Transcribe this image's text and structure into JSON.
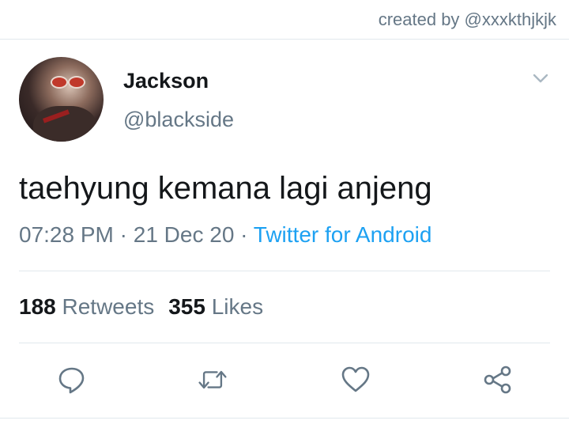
{
  "credit": "created by @xxxkthjkjk",
  "tweet": {
    "author_name": "Jackson",
    "author_handle": "@blackside",
    "text": "taehyung kemana lagi anjeng",
    "time": "07:28 PM",
    "date": "21 Dec 20",
    "separator": "·",
    "source": "Twitter for Android",
    "retweets_count": "188",
    "retweets_label": "Retweets",
    "likes_count": "355",
    "likes_label": "Likes"
  },
  "icons": {
    "menu": "chevron-down-icon",
    "reply": "reply-icon",
    "retweet": "retweet-icon",
    "like": "heart-icon",
    "share": "share-icon"
  },
  "colors": {
    "text": "#14171a",
    "secondary": "#657786",
    "link": "#1da1f2",
    "divider": "#e1e8ed"
  }
}
